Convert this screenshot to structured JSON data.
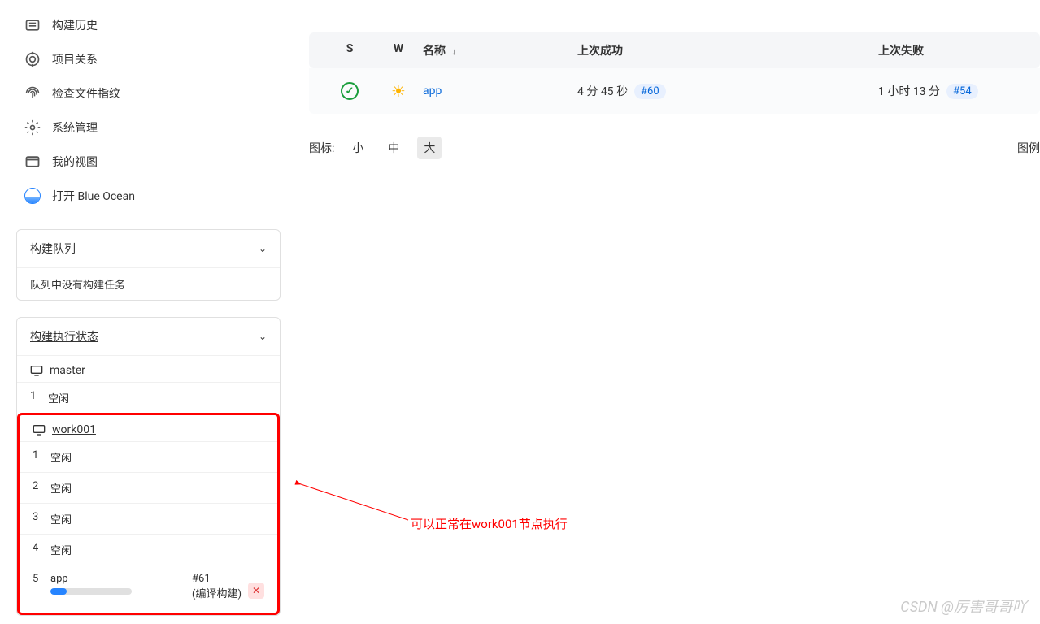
{
  "nav": {
    "build_history": "构建历史",
    "project_relations": "项目关系",
    "check_fingerprint": "检查文件指纹",
    "system_manage": "系统管理",
    "my_views": "我的视图",
    "blue_ocean": "打开 Blue Ocean"
  },
  "queue_panel": {
    "title": "构建队列",
    "empty_text": "队列中没有构建任务"
  },
  "executor_panel": {
    "title": "构建执行状态",
    "nodes": [
      {
        "name": "master",
        "executors": [
          {
            "num": "1",
            "status": "空闲"
          }
        ]
      },
      {
        "name": "work001",
        "executors": [
          {
            "num": "1",
            "status": "空闲"
          },
          {
            "num": "2",
            "status": "空闲"
          },
          {
            "num": "3",
            "status": "空闲"
          },
          {
            "num": "4",
            "status": "空闲"
          },
          {
            "num": "5",
            "job": "app",
            "build": "#61",
            "stage": "(编译构建)"
          }
        ]
      }
    ]
  },
  "table": {
    "headers": {
      "s": "S",
      "w": "W",
      "name": "名称",
      "last_success": "上次成功",
      "last_fail": "上次失败"
    },
    "rows": [
      {
        "name": "app",
        "last_success_time": "4 分 45 秒",
        "last_success_build": "#60",
        "last_fail_time": "1 小时 13 分",
        "last_fail_build": "#54"
      }
    ]
  },
  "icon_size": {
    "label": "图标:",
    "small": "小",
    "medium": "中",
    "large": "大"
  },
  "legend": "图例",
  "annotation": "可以正常在work001节点执行",
  "watermark": "CSDN @厉害哥哥吖"
}
